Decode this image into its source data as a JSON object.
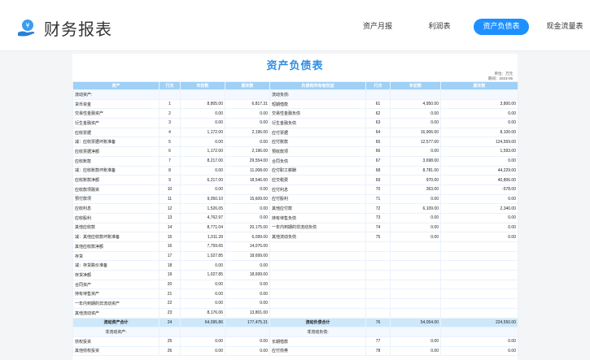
{
  "app": {
    "title": "财务报表"
  },
  "nav": {
    "items": [
      {
        "label": "资产月报"
      },
      {
        "label": "利润表"
      },
      {
        "label": "资产负债表"
      },
      {
        "label": "现金流量表"
      }
    ],
    "active_index": 2
  },
  "colors": {
    "accent": "#1e90ff",
    "title_blue": "#2b8ee6",
    "header_bg": "#9fd0f5"
  },
  "report": {
    "title": "资产负债表",
    "unit": "单位：万元",
    "period": "期间：2023-05",
    "headers": [
      "资产",
      "行次",
      "年初数",
      "期末数",
      "负债和所有者权益",
      "行次",
      "年初数",
      "期末数"
    ],
    "rows": [
      [
        "流动资产:",
        "",
        "",
        "",
        "流动负债:",
        "",
        "",
        ""
      ],
      [
        "货币资金",
        "1",
        "8,805.00",
        "6,817.31",
        "短期借款",
        "61",
        "4,950.00",
        "3,800.00"
      ],
      [
        "交易性金融资产",
        "2",
        "0.00",
        "0.00",
        "交易性金融负债",
        "62",
        "0.00",
        "0.00"
      ],
      [
        "衍生金融资产",
        "3",
        "0.00",
        "0.00",
        "衍生金融负债",
        "63",
        "0.00",
        "0.00"
      ],
      [
        "应收票据",
        "4",
        "1,172.00",
        "2,196.00",
        "应付票据",
        "64",
        "16,906.00",
        "8,100.00"
      ],
      [
        "减：应收票据坏账准备",
        "5",
        "0.00",
        "0.00",
        "应付账款",
        "65",
        "12,577.00",
        "124,559.00"
      ],
      [
        "应收票据净额",
        "6",
        "1,172.00",
        "2,196.00",
        "预收款项",
        "66",
        "0.00",
        "1,593.00"
      ],
      [
        "应收账款",
        "7",
        "8,217.00",
        "29,554.00",
        "合同负债",
        "67",
        "3,698.00",
        "0.00"
      ],
      [
        "减：应收账款坏账准备",
        "8",
        "0.00",
        "11,008.00",
        "应付职工薪酬",
        "68",
        "8,781.00",
        "44,229.00"
      ],
      [
        "应收账款净额",
        "9",
        "6,217.00",
        "18,546.00",
        "应交税费",
        "69",
        "970.00",
        "40,806.00"
      ],
      [
        "应收款项融资",
        "10",
        "0.00",
        "0.00",
        "应付利息",
        "70",
        "363.00",
        "-578.00"
      ],
      [
        "预付款项",
        "11",
        "9,050.10",
        "15,609.00",
        "应付股利",
        "71",
        "0.00",
        "0.00"
      ],
      [
        "应收利息",
        "12",
        "1,526.05",
        "0.00",
        "其他应付款",
        "72",
        "6,109.00",
        "2,340.00"
      ],
      [
        "应收股利",
        "13",
        "4,762.97",
        "0.00",
        "持有待售负债",
        "73",
        "0.00",
        "0.00"
      ],
      [
        "其他应收款",
        "14",
        "8,771.04",
        "20,175.00",
        "一年内到期的非流动负债",
        "74",
        "0.00",
        "0.00"
      ],
      [
        "减：其他应收款坏账准备",
        "15",
        "1,011.39",
        "6,099.00",
        "其他流动负债",
        "75",
        "0.00",
        "0.00"
      ],
      [
        "其他应收款净额",
        "16",
        "7,759.65",
        "14,076.00",
        "",
        "",
        "",
        ""
      ],
      [
        "存货",
        "17",
        "1,027.85",
        "18,699.00",
        "",
        "",
        "",
        ""
      ],
      [
        "减：存货跌价准备",
        "18",
        "0.00",
        "0.00",
        "",
        "",
        "",
        ""
      ],
      [
        "存货净额",
        "19",
        "1,027.85",
        "18,699.00",
        "",
        "",
        "",
        ""
      ],
      [
        "合同资产",
        "20",
        "0.00",
        "0.00",
        "",
        "",
        "",
        ""
      ],
      [
        "持有待售资产",
        "21",
        "0.00",
        "0.00",
        "",
        "",
        "",
        ""
      ],
      [
        "一年内到期的非流动资产",
        "22",
        "0.00",
        "0.00",
        "",
        "",
        "",
        ""
      ],
      [
        "其他流动资产",
        "23",
        "8,176.06",
        "13,801.00",
        "",
        "",
        "",
        ""
      ],
      [
        "流动资产合计",
        "24",
        "64,095.86",
        "177,475.31",
        "流动负债合计",
        "76",
        "54,054.00",
        "224,550.00"
      ],
      [
        "非流动资产:",
        "",
        "",
        "",
        "非流动负债:",
        "",
        "",
        ""
      ],
      [
        "债权投资",
        "25",
        "0.00",
        "0.00",
        "长期借款",
        "77",
        "0.00",
        "0.00"
      ],
      [
        "其他债权投资",
        "26",
        "0.00",
        "0.00",
        "应付债券",
        "78",
        "0.00",
        "0.00"
      ]
    ]
  }
}
